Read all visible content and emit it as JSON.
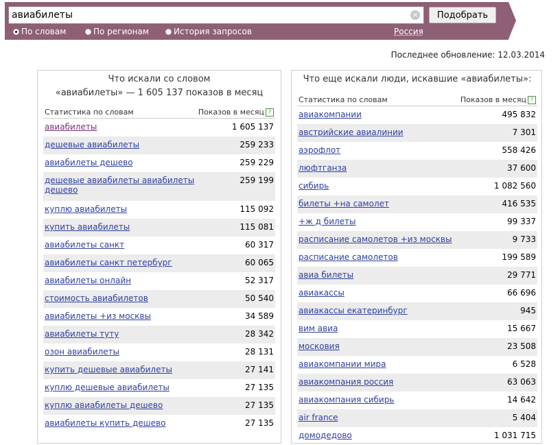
{
  "search": {
    "value": "авиабилеты",
    "button": "Подобрать"
  },
  "modes": [
    "По словам",
    "По регионам",
    "История запросов"
  ],
  "region": "Россия",
  "updated": "Последнее обновление: 12.03.2014",
  "left": {
    "title_line1": "Что искали со словом",
    "title_line2": "«авиабилеты» — 1 605 137 показов в месяц",
    "col_keyword": "Статистика по словам",
    "col_count": "Показов в месяц",
    "help": "?",
    "rows": [
      {
        "k": "авиабилеты",
        "v": "1 605 137"
      },
      {
        "k": "дешевые авиабилеты",
        "v": "259 233"
      },
      {
        "k": "авиабилеты дешево",
        "v": "259 229"
      },
      {
        "k": "дешевые авиабилеты авиабилеты дешево",
        "v": "259 199"
      },
      {
        "k": "куплю авиабилеты",
        "v": "115 092"
      },
      {
        "k": "купить авиабилеты",
        "v": "115 081"
      },
      {
        "k": "авиабилеты санкт",
        "v": "60 317"
      },
      {
        "k": "авиабилеты санкт петербург",
        "v": "60 065"
      },
      {
        "k": "авиабилеты онлайн",
        "v": "52 317"
      },
      {
        "k": "стоимость авиабилетов",
        "v": "50 540"
      },
      {
        "k": "авиабилеты +из москвы",
        "v": "34 589"
      },
      {
        "k": "авиабилеты туту",
        "v": "28 342"
      },
      {
        "k": "озон авиабилеты",
        "v": "28 131"
      },
      {
        "k": "купить дешевые авиабилеты",
        "v": "27 141"
      },
      {
        "k": "куплю дешевые авиабилеты",
        "v": "27 135"
      },
      {
        "k": "куплю авиабилеты дешево",
        "v": "27 135"
      },
      {
        "k": "авиабилеты купить дешево",
        "v": "27 135"
      }
    ]
  },
  "right": {
    "title": "Что еще искали люди, искавшие «авиабилеты»:",
    "col_keyword": "Статистика по словам",
    "col_count": "Показов в месяц",
    "help": "?",
    "rows": [
      {
        "k": "авиакомпании",
        "v": "495 832"
      },
      {
        "k": "австрийские авиалинии",
        "v": "7 301"
      },
      {
        "k": "аэрофлот",
        "v": "558 426"
      },
      {
        "k": "люфтганза",
        "v": "37 600"
      },
      {
        "k": "сибирь",
        "v": "1 082 560"
      },
      {
        "k": "билеты +на самолет",
        "v": "416 535"
      },
      {
        "k": "+ж д билеты",
        "v": "99 337"
      },
      {
        "k": "расписание самолетов +из москвы",
        "v": "9 733"
      },
      {
        "k": "расписание самолетов",
        "v": "199 589"
      },
      {
        "k": "авиа билеты",
        "v": "29 771"
      },
      {
        "k": "авиакассы",
        "v": "66 696"
      },
      {
        "k": "авиакассы екатеринбург",
        "v": "945"
      },
      {
        "k": "вим авиа",
        "v": "15 667"
      },
      {
        "k": "московия",
        "v": "23 508"
      },
      {
        "k": "авиакомпании мира",
        "v": "6 528"
      },
      {
        "k": "авиакомпания россия",
        "v": "63 063"
      },
      {
        "k": "авиакомпания сибирь",
        "v": "14 642"
      },
      {
        "k": "air france",
        "v": "5 404"
      },
      {
        "k": "домодедово",
        "v": "1 031 715"
      }
    ]
  }
}
